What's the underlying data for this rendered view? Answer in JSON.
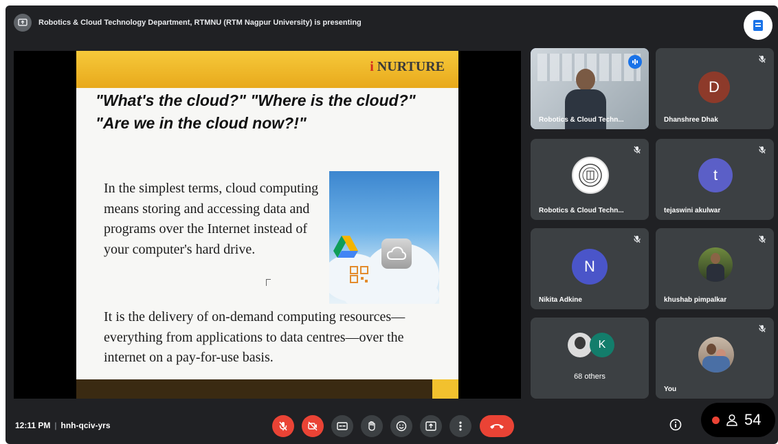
{
  "presentation_banner": {
    "text": "Robotics & Cloud Technology Department, RTMNU (RTM Nagpur University) is presenting"
  },
  "slide": {
    "logo_text": "NURTURE",
    "logo_i": "i",
    "title": "\"What's the cloud?\" \"Where is the cloud?\" \"Are we in the cloud now?!\"",
    "paragraph1": "In the simplest terms, cloud computing means storing and accessing data and programs over the Internet instead of your computer's hard drive.",
    "paragraph2": "It is the delivery of on-demand computing resources—everything from applications to data centres—over the internet on a pay-for-use basis."
  },
  "participants": [
    {
      "name": "Robotics & Cloud Techn...",
      "type": "video",
      "speaking": true
    },
    {
      "name": "Dhanshree Dhak",
      "initial": "D",
      "color": "#8d3a2a",
      "muted": true
    },
    {
      "name": "Robotics & Cloud Techn...",
      "type": "logo",
      "muted": true
    },
    {
      "name": "tejaswini akulwar",
      "initial": "t",
      "color": "#5b5fc7",
      "muted": true
    },
    {
      "name": "Nikita Adkine",
      "initial": "N",
      "color": "#4a55c9",
      "muted": true
    },
    {
      "name": "khushab pimpalkar",
      "type": "photo",
      "muted": true
    },
    {
      "name": "68 others",
      "initial": "K",
      "color": "#137d6b"
    },
    {
      "name": "You",
      "type": "photo",
      "muted": true
    }
  ],
  "bottom_bar": {
    "time": "12:11 PM",
    "meeting_code": "hnh-qciv-yrs",
    "participant_count": "54"
  },
  "colors": {
    "background": "#202124",
    "tile": "#3c4043",
    "danger": "#ea4335",
    "speaking": "#1a73e8"
  },
  "icons": [
    "present-icon",
    "meet-logo-icon",
    "mic-off-icon",
    "camera-off-icon",
    "captions-icon",
    "raise-hand-icon",
    "emoji-icon",
    "present-screen-icon",
    "more-options-icon",
    "end-call-icon",
    "info-icon",
    "people-icon",
    "speaking-indicator-icon"
  ]
}
